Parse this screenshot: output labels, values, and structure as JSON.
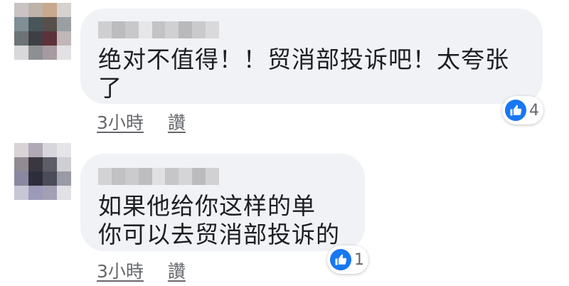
{
  "comments": [
    {
      "text": "绝对不值得！！贸消部投诉吧！太夸张\n了",
      "time": "3小時",
      "like_action": "讚",
      "reaction_count": "4",
      "reaction_icon": "like-icon",
      "avatar_palette": [
        "#c9c4c3",
        "#bdb3a9",
        "#c8a98e",
        "#d6d2cf",
        "#7f8f95",
        "#48565a",
        "#57504a",
        "#9aa0a2",
        "#6c7477",
        "#3e3f44",
        "#5e3238",
        "#c1b7b8",
        "#d8d8da",
        "#8d8f93",
        "#a79aa0",
        "#e2e2e4"
      ],
      "name_blur": [
        "#cfcfd1",
        "#bcbcbf",
        "#c8c8ca",
        "#e6e6e8",
        "#c3c3c6",
        "#d0d0d2",
        "#b9b9bc",
        "#cacacc",
        "#d9d9db"
      ]
    },
    {
      "text": "如果他给你这样的单\n你可以去贸消部投诉的",
      "time": "3小時",
      "like_action": "讚",
      "reaction_count": "1",
      "reaction_icon": "like-icon",
      "avatar_palette": [
        "#d9d3d8",
        "#b1a8b6",
        "#d7d6dc",
        "#e5e5e7",
        "#928b94",
        "#3a3740",
        "#5c5d66",
        "#cfcfd3",
        "#8a88a1",
        "#2e2d3b",
        "#4b4c59",
        "#9a9aa6",
        "#c7c6d6",
        "#9b9ab8",
        "#a3a0b5",
        "#e1e1e6"
      ],
      "name_blur": [
        "#d3d3d5",
        "#c1c1c4",
        "#cbcbcd",
        "#bdbdc0",
        "#e0e0e2",
        "#c6c6c9",
        "#d5d5d7",
        "#bcbcbf",
        "#d1d1d3"
      ]
    }
  ],
  "colors": {
    "bubble": "#f0f2f5",
    "text": "#1c1e21",
    "meta": "#65676b",
    "like_blue": "#1877f2"
  }
}
